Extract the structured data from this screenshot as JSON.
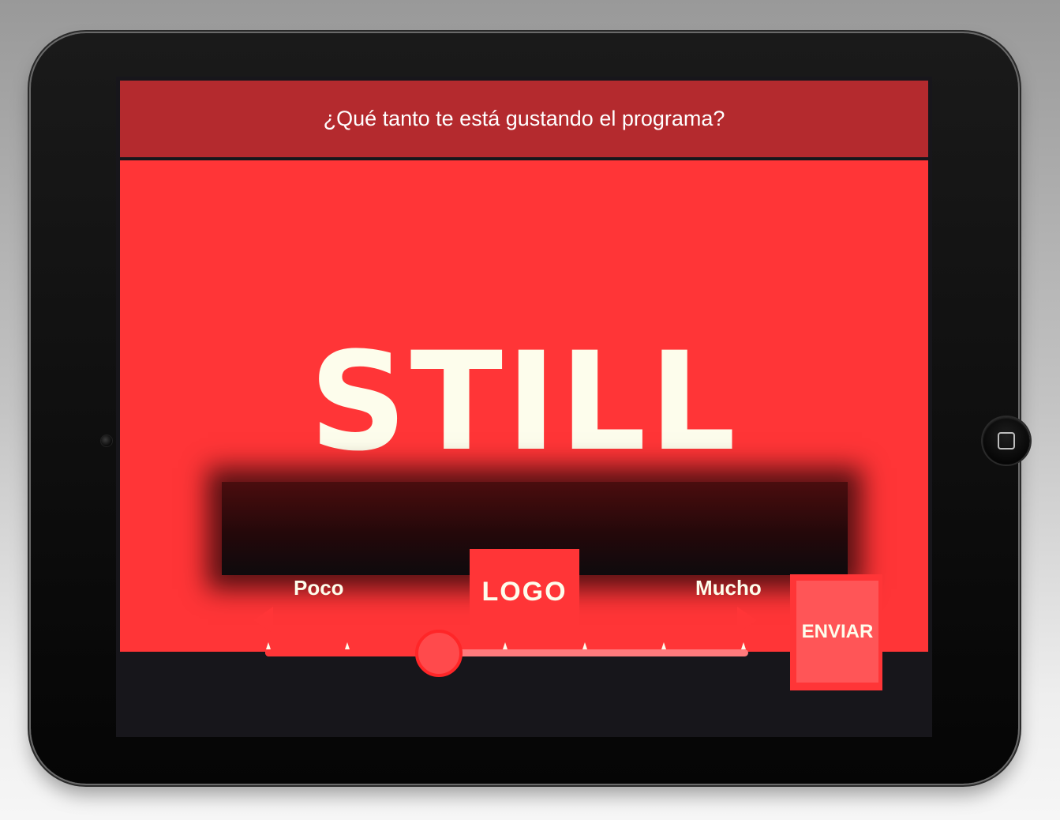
{
  "app": {
    "question": "¿Qué tanto te está gustando el programa?",
    "still_text": "STILL",
    "logo_text": "LOGO"
  },
  "rating": {
    "min_label": "Poco",
    "max_label": "Mucho",
    "tick_count": 7,
    "selected_fraction": 0.36
  },
  "actions": {
    "submit_label": "ENVIAR"
  },
  "device": {
    "type": "tablet",
    "home_button_icon": "home-square-icon",
    "camera_icon": "front-camera-icon"
  },
  "colors": {
    "accent_red": "#ff3537",
    "header_red": "#b42a2e",
    "text_cream": "#fdfdec",
    "track_light": "#ff7a7c",
    "screen_dark": "#17161b"
  }
}
